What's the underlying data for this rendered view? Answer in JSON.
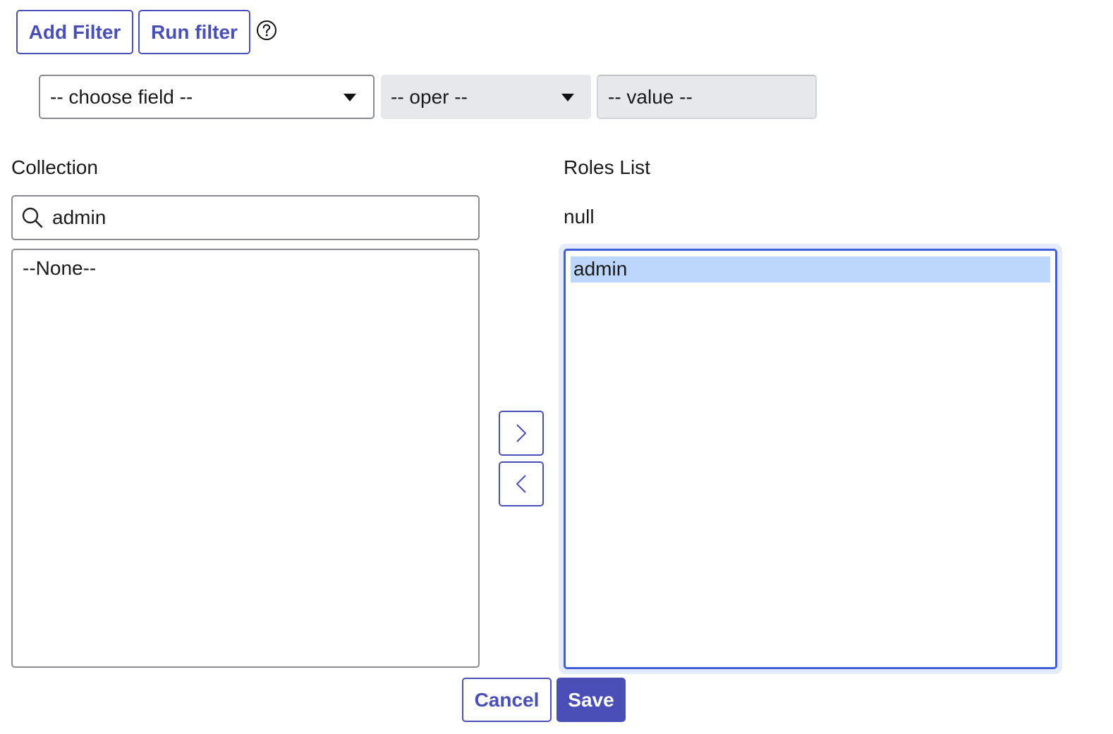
{
  "toolbar": {
    "add_filter_label": "Add Filter",
    "run_filter_label": "Run filter",
    "help_icon": "question-circle-icon"
  },
  "filter": {
    "field_select_value": "-- choose field --",
    "oper_select_value": "-- oper --",
    "value_placeholder": "-- value --"
  },
  "collection": {
    "label": "Collection",
    "search_value": "admin",
    "search_icon": "search-icon",
    "items": [
      "--None--"
    ]
  },
  "roles_list": {
    "label": "Roles List",
    "subtitle": "null",
    "items": [
      "admin"
    ],
    "selected_item": "admin"
  },
  "move": {
    "add_icon": "chevron-right-icon",
    "remove_icon": "chevron-left-icon"
  },
  "footer": {
    "cancel_label": "Cancel",
    "save_label": "Save"
  },
  "colors": {
    "accent": "#4a4fb8",
    "focus_border": "#3f5fd9",
    "selection": "#bcd7fb",
    "disabled_bg": "#e7e8ec"
  }
}
